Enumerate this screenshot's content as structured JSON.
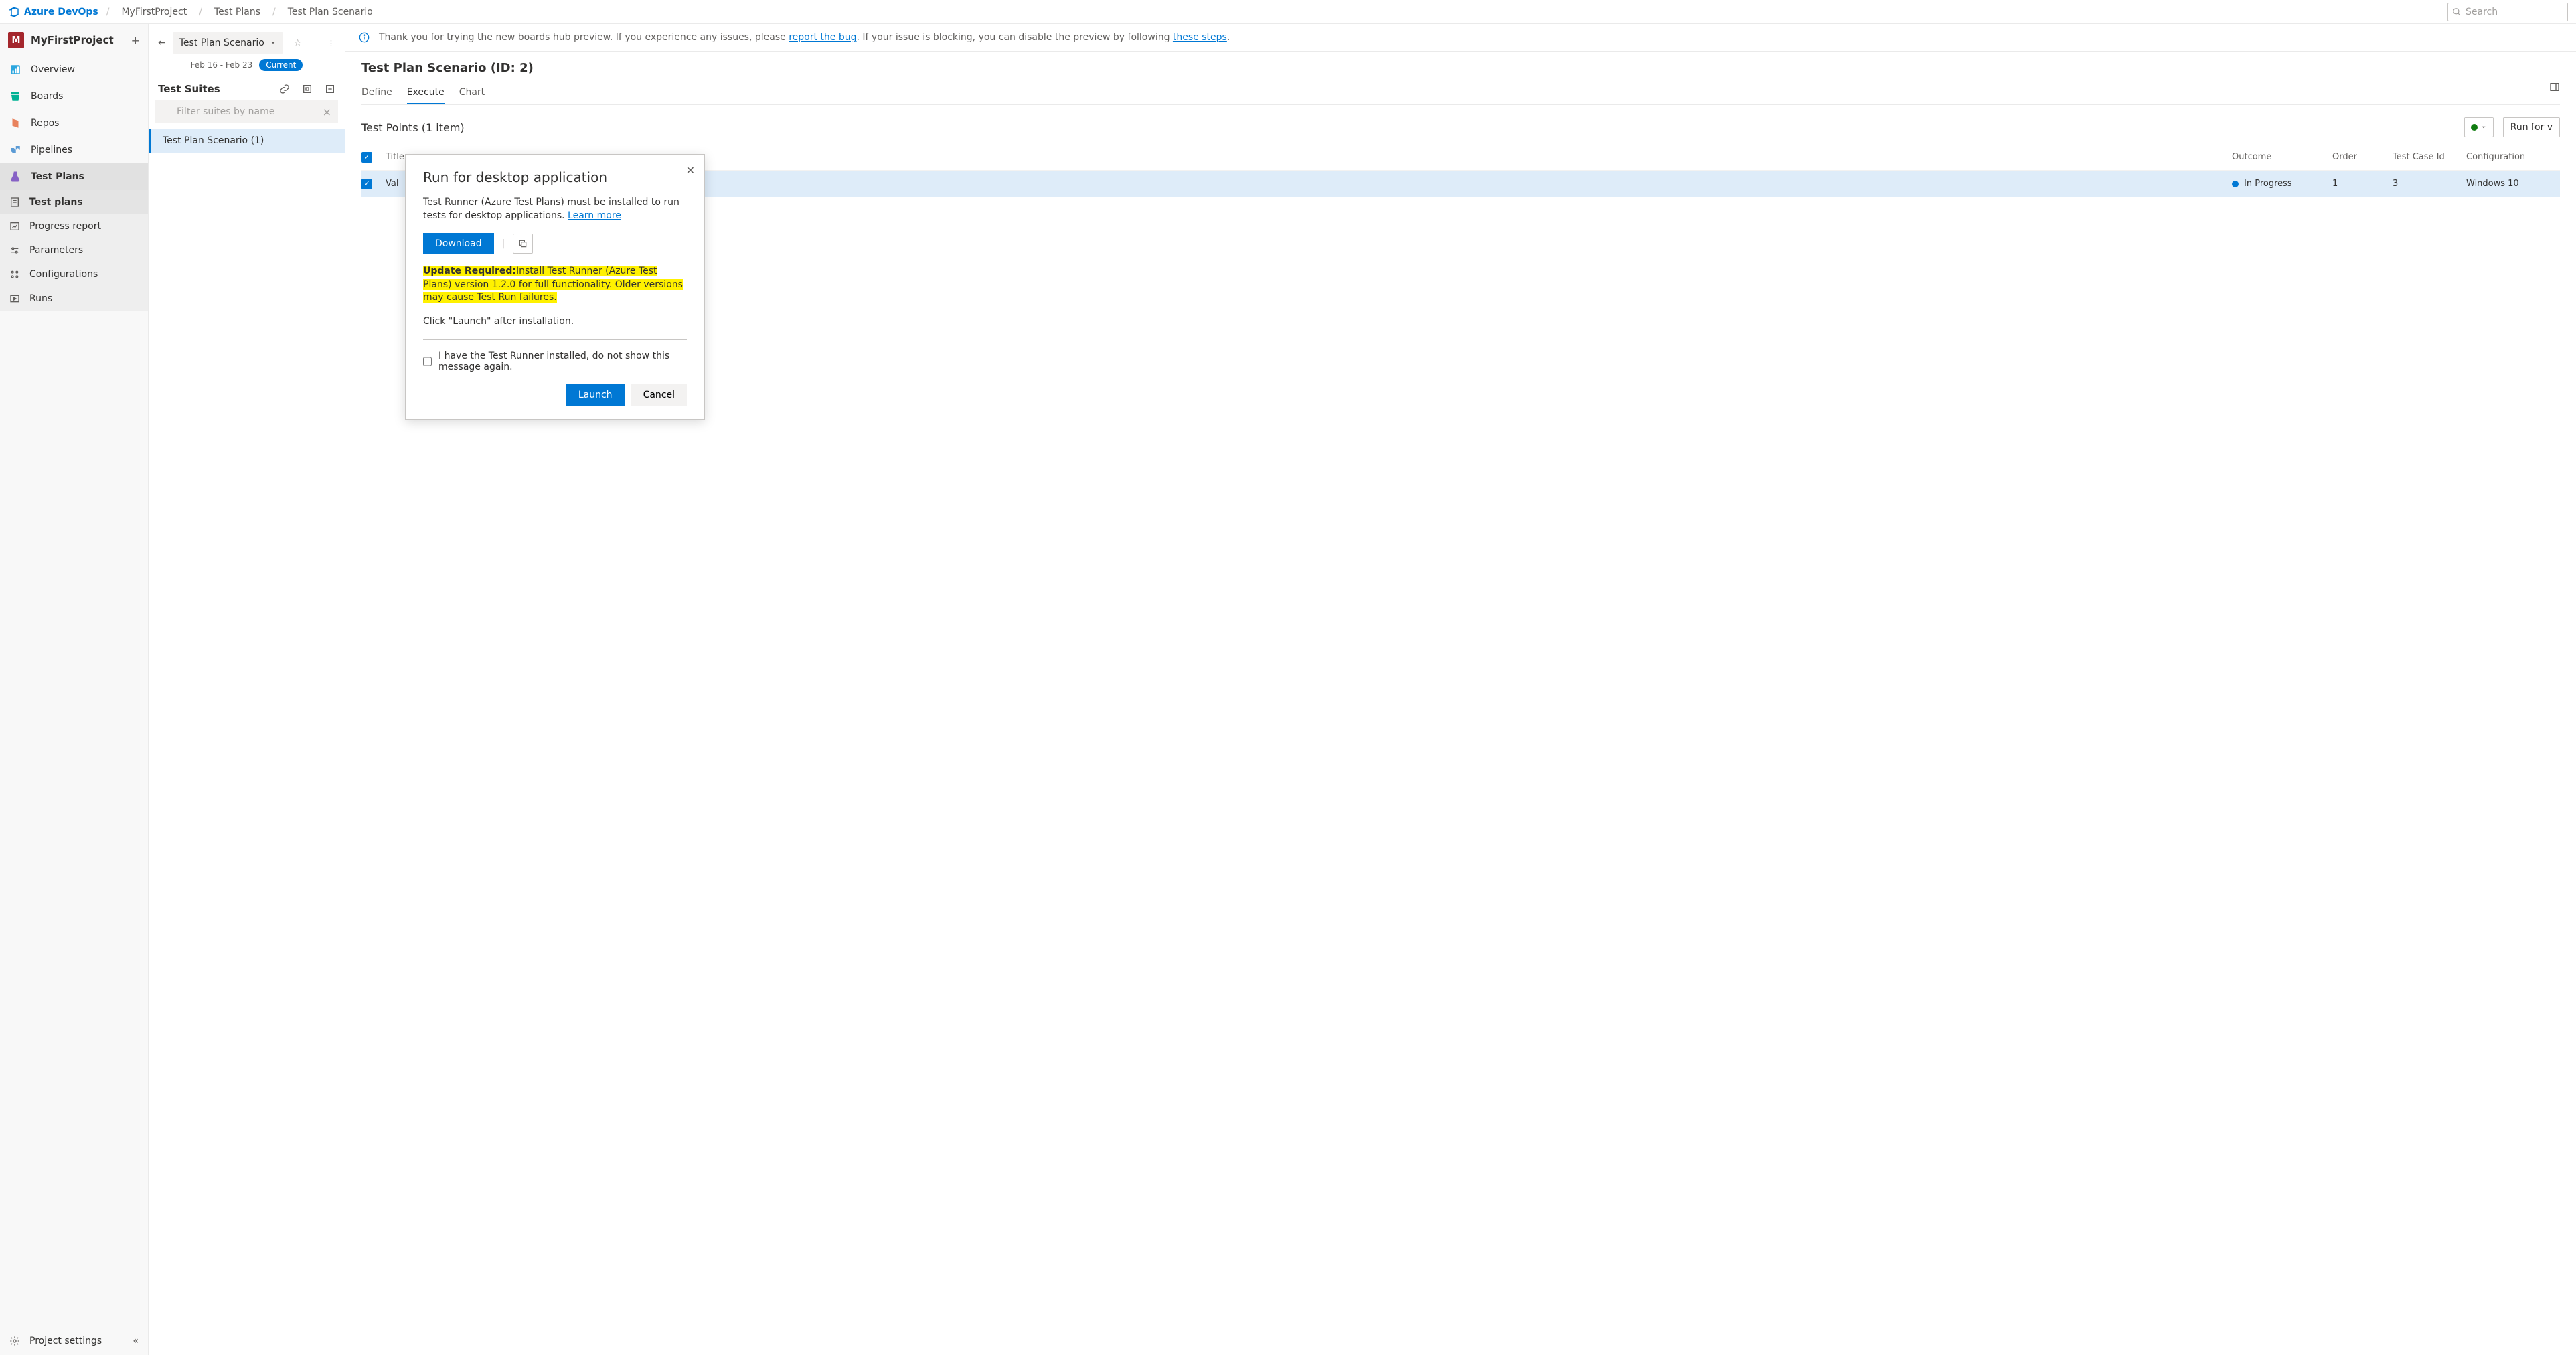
{
  "brand": "Azure DevOps",
  "breadcrumb": [
    "MyFirstProject",
    "Test Plans",
    "Test Plan Scenario"
  ],
  "search_placeholder": "Search",
  "project": {
    "initial": "M",
    "name": "MyFirstProject"
  },
  "nav": {
    "overview": "Overview",
    "boards": "Boards",
    "repos": "Repos",
    "pipelines": "Pipelines",
    "test_plans": "Test Plans"
  },
  "sub_nav": {
    "test_plans": "Test plans",
    "progress_report": "Progress report",
    "parameters": "Parameters",
    "configurations": "Configurations",
    "runs": "Runs"
  },
  "sidebar_footer": "Project settings",
  "suite_panel": {
    "dropdown": "Test Plan Scenario",
    "date_range": "Feb 16 - Feb 23",
    "badge": "Current",
    "label": "Test Suites",
    "filter_placeholder": "Filter suites by name",
    "item": "Test Plan Scenario (1)"
  },
  "banner": {
    "prefix": "Thank you for trying the new boards hub preview. If you experience any issues, please ",
    "link1": "report the bug",
    "middle": ". If your issue is blocking, you can disable the preview by following ",
    "link2": "these steps",
    "suffix": "."
  },
  "content": {
    "title": "Test Plan Scenario (ID: 2)",
    "tabs": {
      "define": "Define",
      "execute": "Execute",
      "chart": "Chart"
    },
    "points_title": "Test Points (1 item)",
    "run_btn": "Run for v",
    "columns": {
      "title": "Title",
      "outcome": "Outcome",
      "order": "Order",
      "tcid": "Test Case Id",
      "config": "Configuration"
    },
    "row": {
      "title": "Val",
      "outcome": "In Progress",
      "order": "1",
      "tcid": "3",
      "config": "Windows 10"
    }
  },
  "modal": {
    "title": "Run for desktop application",
    "para1": "Test Runner (Azure Test Plans) must be installed to run tests for desktop applications. ",
    "learn_more": "Learn more",
    "download": "Download",
    "update_label": "Update Required:",
    "update_text": "Install Test Runner (Azure Test Plans) version 1.2.0 for full functionality. Older versions may cause Test Run failures.",
    "launch_hint": "Click \"Launch\" after installation.",
    "remember": "I have the Test Runner installed, do not show this message again.",
    "launch": "Launch",
    "cancel": "Cancel"
  }
}
